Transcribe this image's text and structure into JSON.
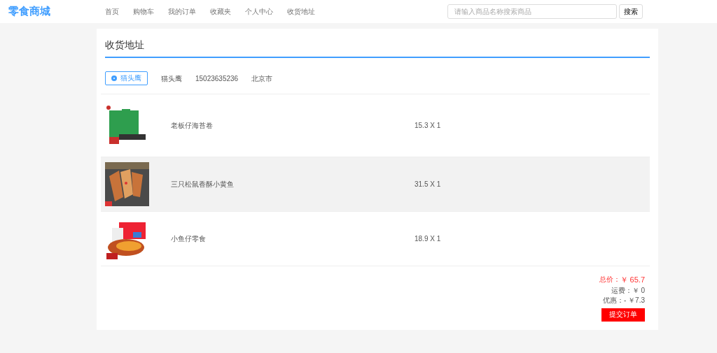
{
  "brand": "零食商城",
  "nav": [
    {
      "label": "首页"
    },
    {
      "label": "购物车"
    },
    {
      "label": "我的订单"
    },
    {
      "label": "收藏夹"
    },
    {
      "label": "个人中心"
    },
    {
      "label": "收货地址"
    }
  ],
  "search": {
    "placeholder": "请输入商品名称搜索商品",
    "button": "搜索"
  },
  "title": "收货地址",
  "addresses": [
    {
      "label": "猫头鹰",
      "selected": true,
      "name": "猫头鹰",
      "phone": "15023635236",
      "city": "北京市"
    }
  ],
  "items": [
    {
      "name": "老板仔海苔卷",
      "price": "15.3 X 1",
      "highlighted": false
    },
    {
      "name": "三只松鼠香酥小黄鱼",
      "price": "31.5 X 1",
      "highlighted": true
    },
    {
      "name": "小鱼仔零食",
      "price": "18.9 X 1",
      "highlighted": false
    }
  ],
  "summary": {
    "total_label": "总价：",
    "total": "￥ 65.7",
    "shipping_label": "运费：",
    "shipping": "￥ 0",
    "discount_label": "优惠：",
    "discount": "- ￥7.3",
    "submit": "提交订单"
  }
}
